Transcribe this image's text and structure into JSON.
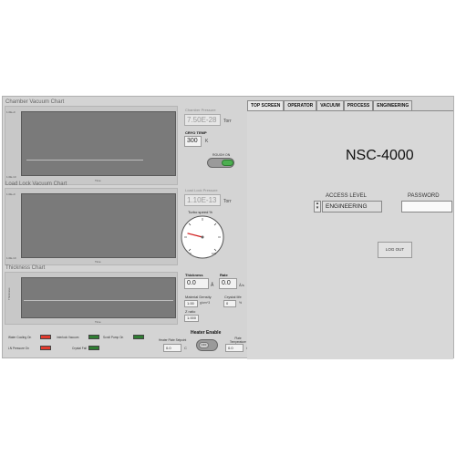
{
  "charts": {
    "chamber": {
      "title": "Chamber Vacuum Chart",
      "xlabel": "Time",
      "ytop": "1.0E+0",
      "ybottom": "1.0E-10"
    },
    "loadlock": {
      "title": "Load Lock Vacuum Chart",
      "xlabel": "Time",
      "ytop": "1.0E+0",
      "ybottom": "1.0E-10"
    },
    "thickness": {
      "title": "Thickness Chart",
      "xlabel": "Time",
      "ylabel": "Thickness"
    }
  },
  "chamber_readout": {
    "label": "Chamber Pressure",
    "value": "7.50E-28",
    "unit": "Torr"
  },
  "cryo": {
    "label": "CRYO TEMP",
    "value": "300",
    "unit": "K"
  },
  "rough_button": {
    "label": "ROUGH ON"
  },
  "loadlock_readout": {
    "label": "Load Lock Pressure",
    "value": "1.10E-13",
    "unit": "Torr"
  },
  "turbo": {
    "label": "Turbo speed %",
    "min": "0",
    "max": "100",
    "level": 0.22
  },
  "thickness_readout": {
    "label": "Thickness",
    "value": "0.0",
    "unit": "Å"
  },
  "rate_readout": {
    "label": "Rate",
    "value": "0.0",
    "unit": "Å/s"
  },
  "material_density": {
    "label": "Material Density",
    "value": "1.00",
    "unit": "g/cm^3"
  },
  "crystal_life": {
    "label": "Crystal life",
    "value": "0",
    "unit": "%"
  },
  "z_ratio": {
    "label": "Z ratio",
    "value": "1.000"
  },
  "status_leds": [
    {
      "label": "Water Cooling On",
      "color": "#e23b2e"
    },
    {
      "label": "Interlock Vacuum",
      "color": "#2f7d32"
    },
    {
      "label": "Scroll Pump On",
      "color": "#2f7d32"
    },
    {
      "label": "LN Pressure On",
      "color": "#e23b2e"
    },
    {
      "label": "Crystal Fail",
      "color": "#2f7d32"
    }
  ],
  "heater": {
    "title": "Heater Enable",
    "setpoint_label": "Heater Plate Setpoint",
    "setpoint_value": "0.0",
    "setpoint_unit": "C",
    "toggle_label": "OFF",
    "temp_label": "Plate Temperature",
    "temp_value": "0.0",
    "temp_unit": "C"
  },
  "tabs": [
    "TOP SCREEN",
    "OPERATOR",
    "VACUUM",
    "PROCESS",
    "ENGINEERING"
  ],
  "right": {
    "system_name": "NSC-4000",
    "access_level_label": "ACCESS LEVEL",
    "access_level_value": "ENGINEERING",
    "password_label": "PASSWORD",
    "password_value": "",
    "logout_label": "LOG OUT"
  },
  "colors": {
    "red_led": "#e23b2e",
    "green_led": "#2f7d32",
    "needle": "#d01818"
  }
}
